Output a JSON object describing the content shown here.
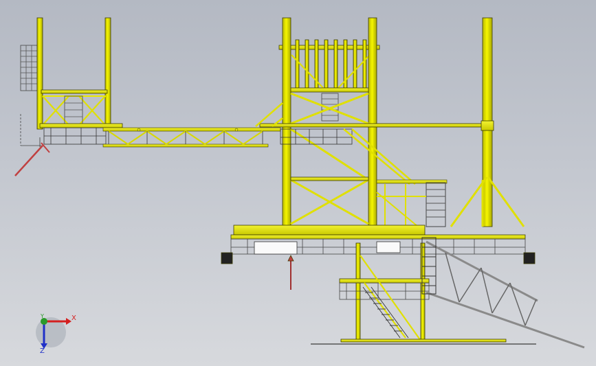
{
  "view": {
    "background_top": "#b4b9c3",
    "background_bottom": "#d7d9dd",
    "structure_color": "#e8e800",
    "structure_edge": "#3a3a00",
    "boom_color": "#c9c9c9",
    "accent_red": "#c04040"
  },
  "triad": {
    "x_label": "X",
    "y_label": "Y",
    "z_label": "Z",
    "x_color": "#d42020",
    "y_color": "#2a9a2a",
    "z_color": "#2030c8"
  }
}
